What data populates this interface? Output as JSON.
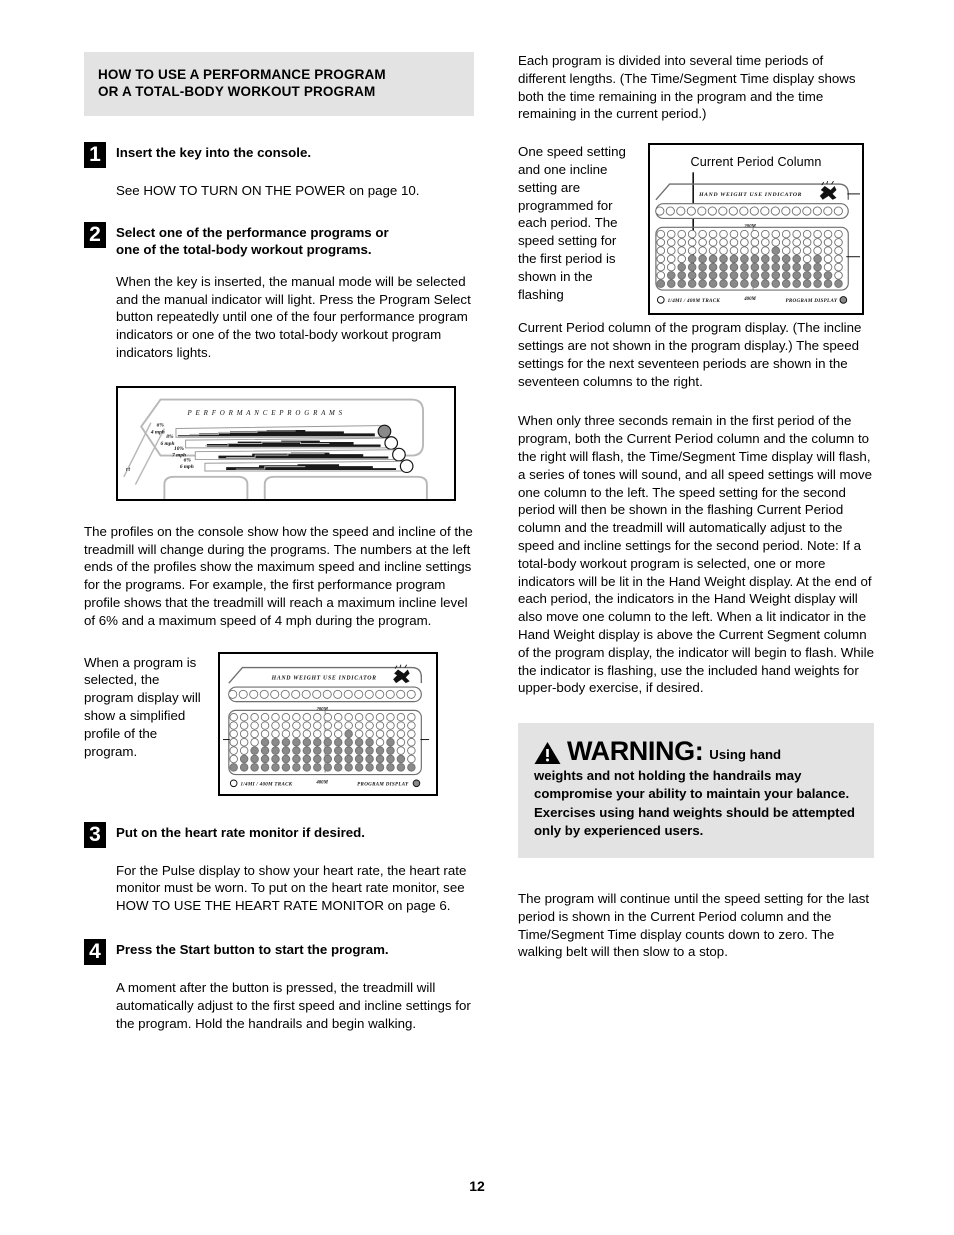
{
  "page": {
    "number": "12"
  },
  "section_header": {
    "line1": "HOW TO USE A PERFORMANCE PROGRAM",
    "line2": "OR A TOTAL-BODY WORKOUT PROGRAM"
  },
  "steps": [
    {
      "number": "1",
      "title": "Insert the key into the console.",
      "body": "See HOW TO TURN ON THE POWER on page 10."
    },
    {
      "number": "2",
      "title_line1": "Select one of the performance programs or",
      "title_line2": "one of the total-body workout programs.",
      "body": "When the key is inserted, the manual mode will be selected and the manual indicator will light. Press the Program Select button repeatedly until one of the four performance program indicators or one of the two total-body workout program indicators lights."
    },
    {
      "number": "3",
      "title": "Put on the heart rate monitor if desired.",
      "body": "For the Pulse display to show your heart rate, the heart rate monitor must be worn. To put on the heart rate monitor, see HOW TO USE THE HEART RATE MONITOR on page 6."
    },
    {
      "number": "4",
      "title": "Press the Start button to start the program.",
      "body": "A moment after the button is pressed, the treadmill will automatically adjust to the first speed and incline settings for the program. Hold the handrails and begin walking."
    }
  ],
  "left_column": {
    "profiles_paragraph": "The profiles on the console show how the speed and incline of the treadmill will change during the programs. The numbers at the left ends of the profiles show the maximum speed and incline settings for the programs. For example, the first performance program profile shows that the treadmill will reach a maximum incline level of 6% and a maximum speed of 4 mph during the program.",
    "program_display_paragraph": "When a program is selected, the program display will show a simplified profile of the program."
  },
  "performance_figure": {
    "title": "P E R F O R M A N C E   P R O G R A M S",
    "edge_label": "rt",
    "profiles": [
      {
        "incline": "6%",
        "speed": "4 mph",
        "selected": true
      },
      {
        "incline": "8%",
        "speed": "6 mph",
        "selected": false
      },
      {
        "incline": "10%",
        "speed": "7 mph",
        "selected": false
      },
      {
        "incline": "6%",
        "speed": "6 mph",
        "selected": false
      }
    ]
  },
  "program_display_figure": {
    "hand_weight_label": "HAND  WEIGHT  USE  INDICATOR",
    "mid_marker": "200M",
    "bottom_marker": "400M",
    "track_label": "1/4MI / 400M TRACK",
    "display_label": "PROGRAM DISPLAY",
    "columns": 18,
    "rows": 7,
    "bar_heights": [
      1,
      2,
      3,
      4,
      4,
      4,
      4,
      4,
      4,
      4,
      4,
      5,
      4,
      4,
      3,
      4,
      2,
      1
    ]
  },
  "right_column": {
    "intro_paragraph": "Each program is divided into several time periods of different lengths. (The Time/Segment Time display shows both the time remaining in the program and the time remaining in the current period.)",
    "callout_label": "Current Period Column",
    "narrow_paragraph": "One speed setting and one incline setting are programmed for each period. The speed setting for the first period is shown in the flashing",
    "continued_paragraph": "Current Period column of the program display. (The incline settings are not shown in the program display.) The speed settings for the next seventeen periods are shown in the seventeen columns to the right.",
    "three_seconds_paragraph": "When only three seconds remain in the first period of the program, both the Current Period column and the column to the right will flash, the Time/Segment Time display will flash, a series of tones will sound, and all speed settings will move one column to the left. The speed setting for the second period will then be shown in the flashing Current Period column and the treadmill will automatically adjust to the speed and incline settings for the second period. Note: If a total-body workout program is selected, one or more indicators will be lit in the Hand Weight display. At the end of each period, the indicators in the Hand Weight display will also move one column to the left. When a lit indicator in the Hand Weight display is above the Current Segment column of the program display, the indicator will begin to flash. While the indicator is flashing, use the included hand weights for upper-body exercise, if desired.",
    "closing_paragraph": "The program will continue until the speed setting for the last period is shown in the Current Period column and the Time/Segment Time display counts down to zero. The walking belt will then slow to a stop."
  },
  "warning": {
    "word": "WARNING:",
    "lead": "Using hand",
    "rest": "weights and not holding the handrails may compromise your ability to maintain your balance. Exercises using hand weights should be attempted only by experienced users."
  },
  "colors": {
    "band_gray": "#e3e3e3",
    "ink": "#000000",
    "dot_fill": "#8a8a8a",
    "paper": "#ffffff"
  }
}
